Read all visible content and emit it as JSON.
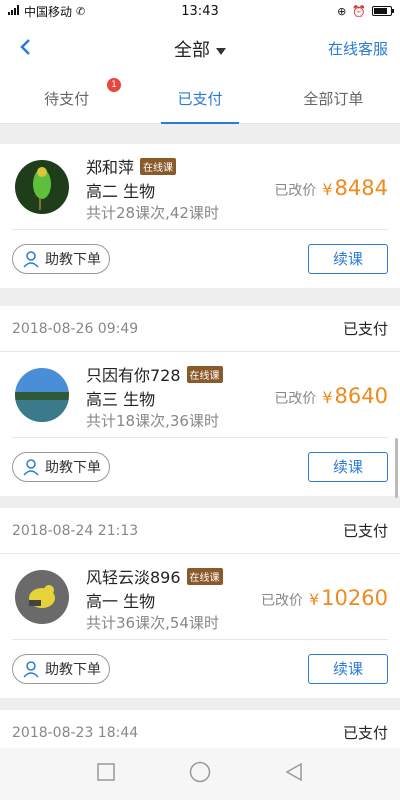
{
  "status_bar": {
    "carrier": "中国移动",
    "time": "13:43"
  },
  "nav": {
    "title": "全部",
    "customer_service": "在线客服"
  },
  "tabs": [
    {
      "label": "待支付",
      "badge": "1"
    },
    {
      "label": "已支付"
    },
    {
      "label": "全部订单"
    }
  ],
  "orders": [
    {
      "date": "",
      "status": "",
      "name": "郑和萍",
      "tag": "在线课",
      "grade_subject": "高二 生物",
      "meta": "共计28课次,42课时",
      "price_label": "已改价",
      "currency": "¥",
      "price": "8484",
      "assist_label": "助教下单",
      "renew_label": "续课"
    },
    {
      "date": "2018-08-26 09:49",
      "status": "已支付",
      "name": "只因有你728",
      "tag": "在线课",
      "grade_subject": "高三 生物",
      "meta": "共计18课次,36课时",
      "price_label": "已改价",
      "currency": "¥",
      "price": "8640",
      "assist_label": "助教下单",
      "renew_label": "续课"
    },
    {
      "date": "2018-08-24 21:13",
      "status": "已支付",
      "name": "风轻云淡896",
      "tag": "在线课",
      "grade_subject": "高一 生物",
      "meta": "共计36课次,54课时",
      "price_label": "已改价",
      "currency": "¥",
      "price": "10260",
      "assist_label": "助教下单",
      "renew_label": "续课"
    },
    {
      "date": "2018-08-23 18:44",
      "status": "已支付"
    }
  ],
  "icons": {
    "back": "chevron-left-icon",
    "user": "user-outline-icon",
    "home": "square-icon",
    "circle": "circle-icon",
    "triangle": "back-triangle-icon"
  },
  "colors": {
    "accent": "#2a7bd4",
    "price": "#ef8a1d",
    "tag": "#8a5a2b",
    "badge": "#e8463e"
  }
}
